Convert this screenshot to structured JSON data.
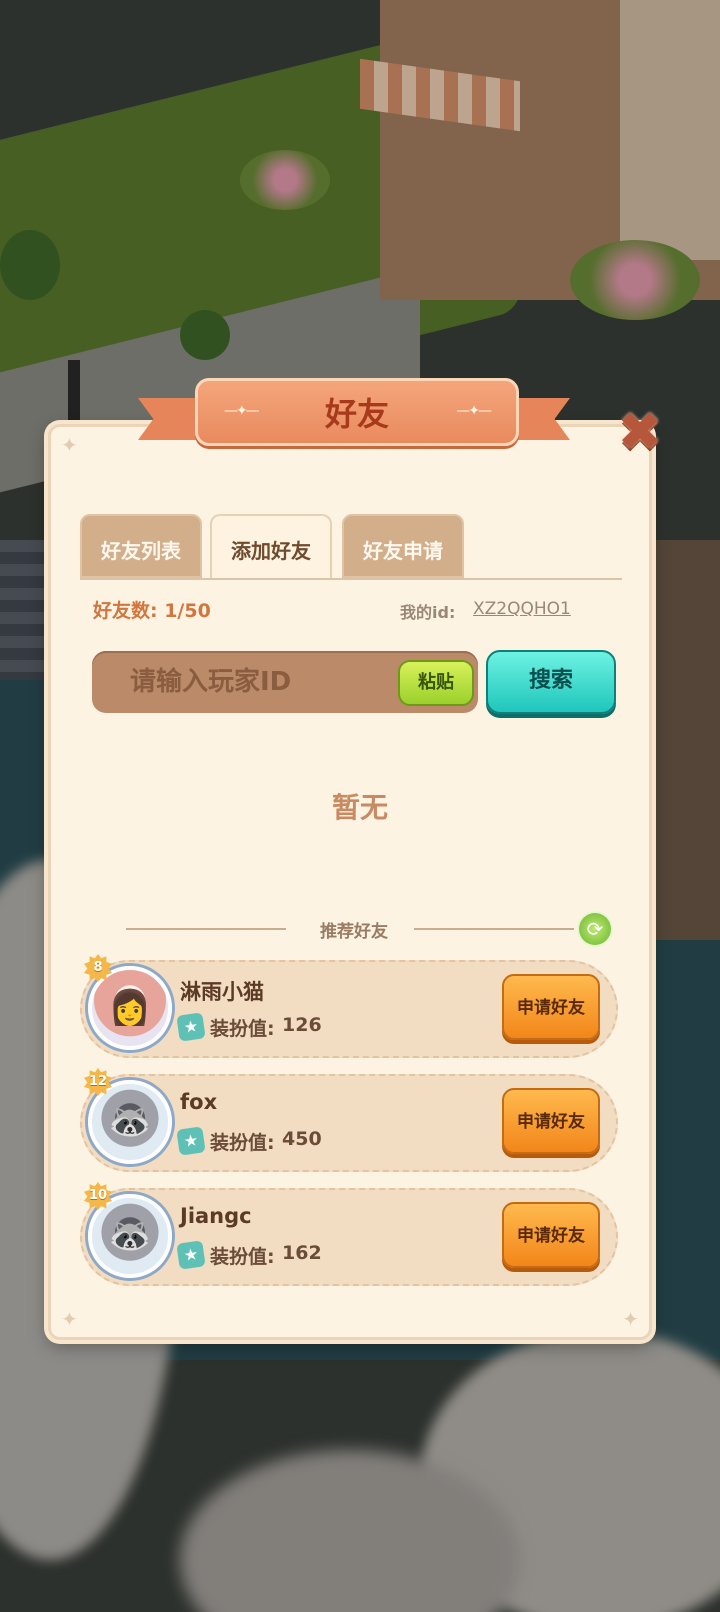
{
  "title": "好友",
  "tabs": [
    {
      "label": "好友列表",
      "active": false
    },
    {
      "label": "添加好友",
      "active": true
    },
    {
      "label": "好友申请",
      "active": false
    }
  ],
  "friend_count_label": "好友数: 1/50",
  "my_id_label": "我的id:",
  "my_id_value": "XZ2QQHO1",
  "search": {
    "placeholder": "请输入玩家ID",
    "paste_label": "粘贴",
    "search_label": "搜索"
  },
  "empty_text": "暂无",
  "recommend_title": "推荐好友",
  "recommendations": [
    {
      "level": "8",
      "name": "淋雨小猫",
      "deco_label": "装扮值:",
      "deco_value": "126",
      "button": "申请好友",
      "avatar": "girl"
    },
    {
      "level": "12",
      "name": "fox",
      "deco_label": "装扮值:",
      "deco_value": "450",
      "button": "申请好友",
      "avatar": "raccoon"
    },
    {
      "level": "10",
      "name": "Jiangc",
      "deco_label": "装扮值:",
      "deco_value": "162",
      "button": "申请好友",
      "avatar": "raccoon"
    }
  ],
  "colors": {
    "accent": "#e98a5f",
    "search_button": "#1fc6bc",
    "paste_button": "#9bd02c",
    "apply_button": "#f2861a"
  }
}
